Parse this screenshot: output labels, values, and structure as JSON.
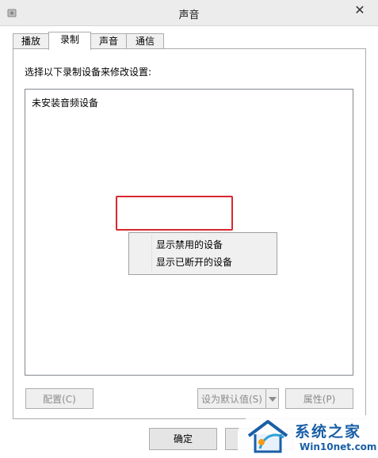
{
  "window": {
    "title": "声音",
    "close_label": "✕"
  },
  "tabs": [
    {
      "label": "播放",
      "active": false
    },
    {
      "label": "录制",
      "active": true
    },
    {
      "label": "声音",
      "active": false
    },
    {
      "label": "通信",
      "active": false
    }
  ],
  "recording": {
    "instruction": "选择以下录制设备来修改设置:",
    "empty_message": "未安装音频设备"
  },
  "context_menu": {
    "items": [
      "显示禁用的设备",
      "显示已断开的设备"
    ],
    "highlight_color": "#d9272e"
  },
  "buttons": {
    "configure": "配置(C)",
    "set_default": "设为默认值(S)",
    "properties": "属性(P)",
    "ok": "确定"
  },
  "watermark": {
    "name": "系统之家",
    "url": "Win10net.com"
  },
  "colors": {
    "titlebar": "#ececec",
    "accent": "#1a5fa6",
    "disabled_text": "#8b8b8b"
  }
}
